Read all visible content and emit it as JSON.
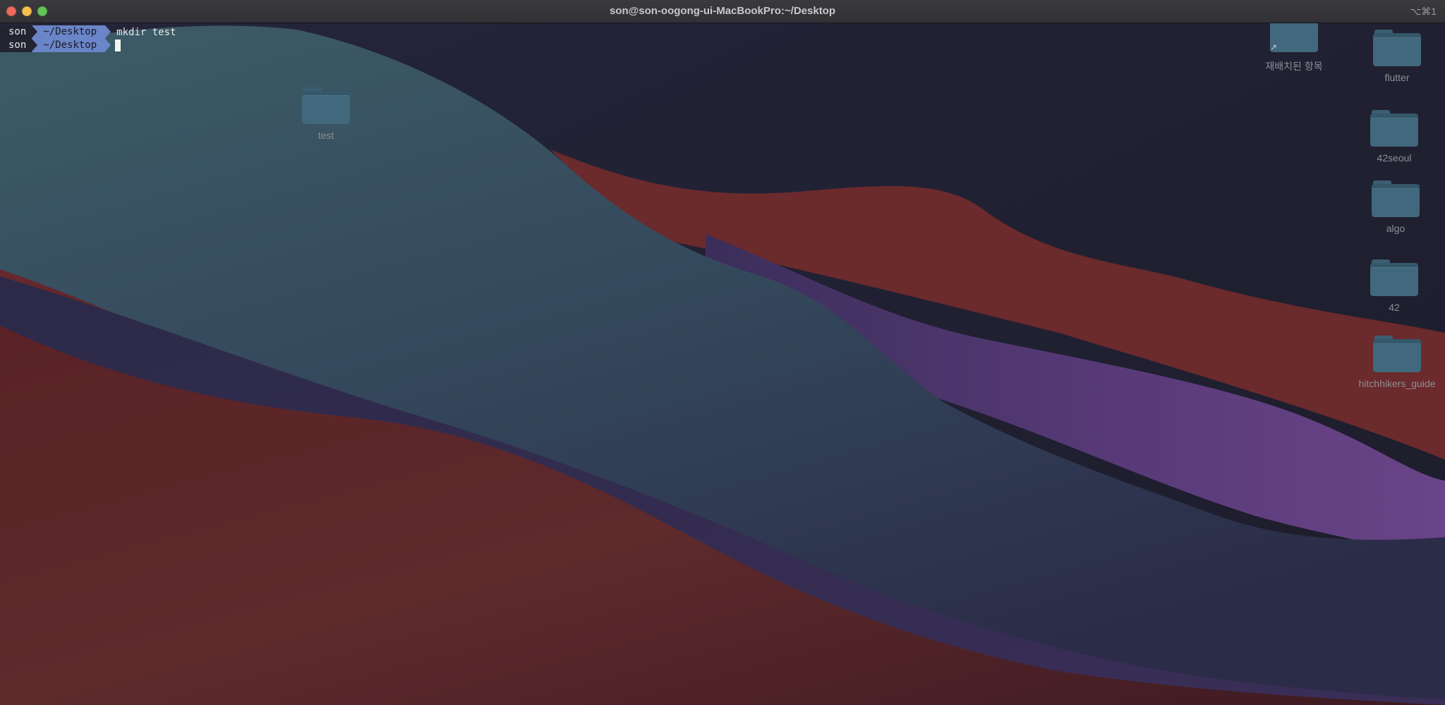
{
  "window": {
    "title": "son@son-oogong-ui-MacBookPro:~/Desktop",
    "shortcut": "⌥⌘1"
  },
  "terminal": {
    "lines": [
      {
        "user": "son",
        "path": "~/Desktop",
        "command": "mkdir test"
      },
      {
        "user": "son",
        "path": "~/Desktop",
        "command": ""
      }
    ]
  },
  "desktop": {
    "icons": [
      {
        "label": "test",
        "icon": "folder-icon"
      },
      {
        "label": "재배치된 항목",
        "icon": "folder-alias-icon"
      },
      {
        "label": "flutter",
        "icon": "folder-icon"
      },
      {
        "label": "42seoul",
        "icon": "folder-icon"
      },
      {
        "label": "algo",
        "icon": "folder-icon"
      },
      {
        "label": "42",
        "icon": "folder-icon"
      },
      {
        "label": "hitchhikers_guide",
        "icon": "folder-icon"
      }
    ]
  },
  "colors": {
    "close": "#ed6a5e",
    "minimize": "#f5bf4f",
    "zoom": "#62c554",
    "prompt_path_bg": "#6a85c8",
    "prompt_user_bg": "#232332"
  }
}
